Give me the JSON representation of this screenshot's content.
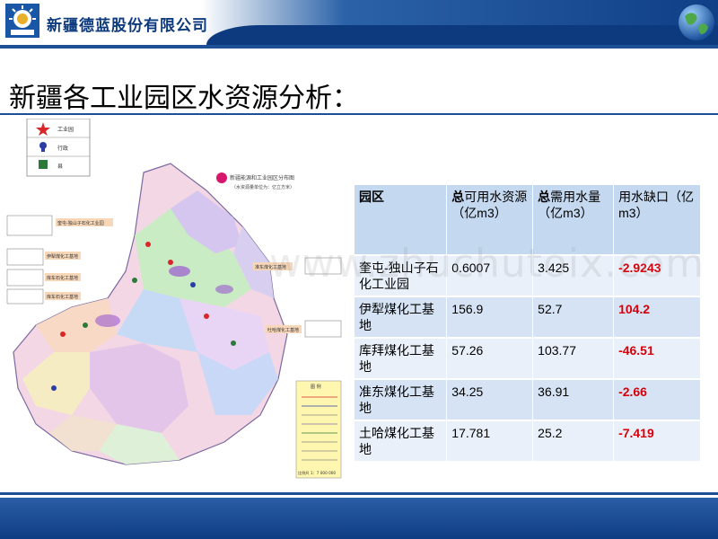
{
  "header": {
    "company_name": "新疆德蓝股份有限公司"
  },
  "page_title": "新疆各工业园区水资源分析：",
  "map": {
    "legend_top": [
      {
        "label": "工业园",
        "icon": "star-icon"
      },
      {
        "label": "行政",
        "icon": "fleur-icon"
      },
      {
        "label": "县",
        "icon": "square-icon"
      }
    ],
    "title": "新疆能源和工业园区分布图",
    "subtitle": "（水资源量单位为：亿立方米）",
    "callouts": [
      "奎屯-独山子石化工业园",
      "伊犁煤化工基地",
      "库车石化工基地",
      "库车石化工基地",
      "准东煤化工基地",
      "吐哈煤化工基地"
    ],
    "legend_box_title": "图 例",
    "scale_text": "比例尺 1：7 000 000"
  },
  "table": {
    "headers": [
      {
        "bold": "园区",
        "rest": ""
      },
      {
        "bold": "总",
        "rest": "可用水资源（亿m3）"
      },
      {
        "bold": "总",
        "rest": "需用水量（亿m3）"
      },
      {
        "bold": "",
        "rest": "用水缺口（亿m3）"
      }
    ],
    "rows": [
      {
        "park": "奎屯-独山子石化工业园",
        "available": "0.6007",
        "required": "3.425",
        "gap": "-2.9243"
      },
      {
        "park": "伊犁煤化工基地",
        "available": "156.9",
        "required": "52.7",
        "gap": "104.2"
      },
      {
        "park": "库拜煤化工基地",
        "available": "57.26",
        "required": "103.77",
        "gap": "-46.51"
      },
      {
        "park": "准东煤化工基地",
        "available": "34.25",
        "required": "36.91",
        "gap": "-2.66"
      },
      {
        "park": "土哈煤化工基地",
        "available": "17.781",
        "required": "25.2",
        "gap": "-7.419"
      }
    ]
  },
  "watermark": "www.zhuchutoix.com",
  "colors": {
    "gap_color": "#d6000a",
    "header_blue": "#0f3f86",
    "table_bg": "#cfe0f3"
  }
}
